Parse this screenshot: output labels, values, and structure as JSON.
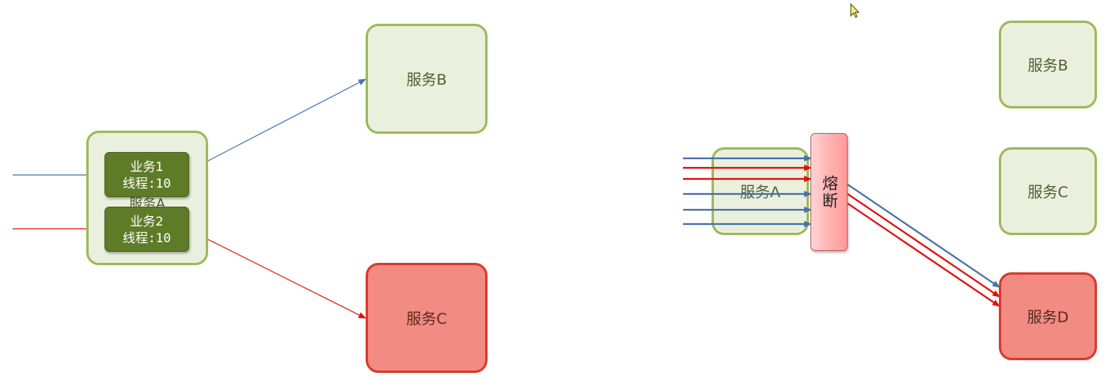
{
  "left_diagram": {
    "service_a": "服务A",
    "service_b": "服务B",
    "service_c": "服务C",
    "task1": {
      "name": "业务1",
      "thread": "线程:10"
    },
    "task2": {
      "name": "业务2",
      "thread": "线程:10"
    }
  },
  "right_diagram": {
    "service_a": "服务A",
    "breaker": "熔断",
    "service_b": "服务B",
    "service_c": "服务C",
    "service_d": "服务D"
  },
  "colors": {
    "green_fill": "#ebf0de",
    "green_border": "#9bbb59",
    "red_fill": "#f28b82",
    "red_border": "#d83a2e",
    "blue_arrow": "#4a72a8",
    "red_arrow": "#e01010",
    "task_fill": "#5e7c28"
  },
  "icons": {
    "cursor": "mouse-pointer-icon"
  }
}
